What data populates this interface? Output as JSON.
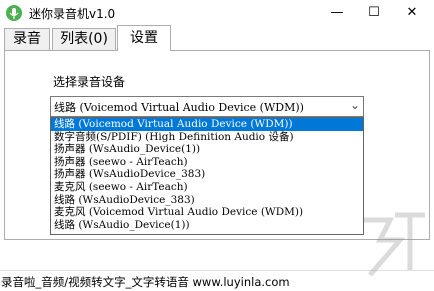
{
  "window": {
    "title": "迷你录音机v1.0",
    "min_glyph": "—",
    "max_glyph": "☐",
    "close_glyph": "✕"
  },
  "tabs": [
    {
      "label": "录音"
    },
    {
      "label": "列表(0)"
    },
    {
      "label": "设置"
    }
  ],
  "settings": {
    "device_label": "选择录音设备",
    "selected_device": "线路 (Voicemod Virtual Audio Device (WDM))",
    "arrow_glyph": "⌄",
    "devices": [
      "线路 (Voicemod Virtual Audio Device (WDM))",
      "数字音频(S/PDIF) (High Definition Audio 设备)",
      "扬声器 (WsAudio_Device(1))",
      "扬声器 (seewo - AirTeach)",
      "扬声器 (WsAudioDevice_383)",
      "麦克风 (seewo - AirTeach)",
      "线路 (WsAudioDevice_383)",
      "麦克风 (Voicemod Virtual Audio Device (WDM))",
      "线路 (WsAudio_Device(1))"
    ]
  },
  "status": {
    "text": "录音啦_音频/视频转文字_文字转语音 www.luyinla.com"
  },
  "colors": {
    "selection": "#0078d7",
    "app_icon_green": "#4caf50"
  }
}
